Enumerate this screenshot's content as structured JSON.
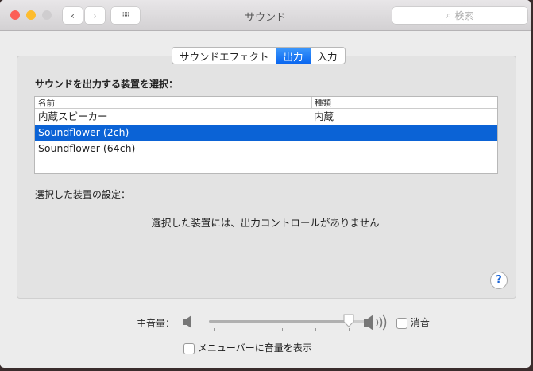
{
  "window": {
    "title": "サウンド",
    "search_placeholder": "検索"
  },
  "tabs": [
    {
      "label": "サウンドエフェクト",
      "active": false
    },
    {
      "label": "出力",
      "active": true
    },
    {
      "label": "入力",
      "active": false
    }
  ],
  "device_heading": "サウンドを出力する装置を選択：",
  "table": {
    "columns": [
      "名前",
      "種類"
    ],
    "rows": [
      [
        "内蔵スピーカー",
        "内蔵"
      ],
      [
        "Soundflower (2ch)",
        ""
      ],
      [
        "Soundflower (64ch)",
        ""
      ]
    ],
    "selected_index": 1
  },
  "settings_label": "選択した装置の設定：",
  "no_controls_message": "選択した装置には、出力コントロールがありません",
  "help": "?",
  "volume": {
    "label": "主音量：",
    "value": 1.0,
    "mute_label": "消音",
    "mute_checked": false
  },
  "menubar_checkbox": {
    "label": "メニューバーに音量を表示",
    "checked": false
  },
  "colors": {
    "accent": "#0b63d6"
  }
}
